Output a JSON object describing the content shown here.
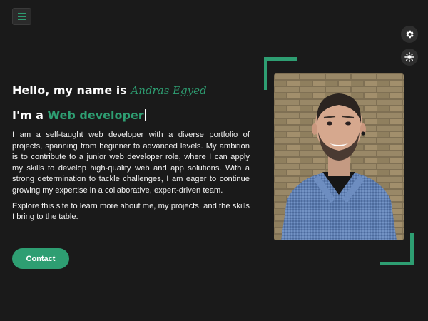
{
  "header": {
    "menu_icon": "hamburger-icon"
  },
  "side_controls": [
    {
      "icon": "gear-icon"
    },
    {
      "icon": "sun-icon"
    }
  ],
  "hero": {
    "greeting": "Hello, my name is ",
    "name": "Andras Egyed",
    "role_prefix": "I'm a ",
    "role": "Web developer",
    "paragraph_1": "I am a self-taught web developer with a diverse portfolio of projects, spanning from beginner to advanced levels. My ambition is to contribute to a junior web developer role, where I can apply my skills to develop high-quality web and app solutions. With a strong determination to tackle challenges, I am eager to continue growing my expertise in a collaborative, expert-driven team.",
    "paragraph_2": "Explore this site to learn more about me, my projects, and the skills I bring to the table.",
    "contact_label": "Contact"
  },
  "colors": {
    "accent": "#2e9e72",
    "background": "#1a1a1a",
    "text": "#ffffff"
  }
}
